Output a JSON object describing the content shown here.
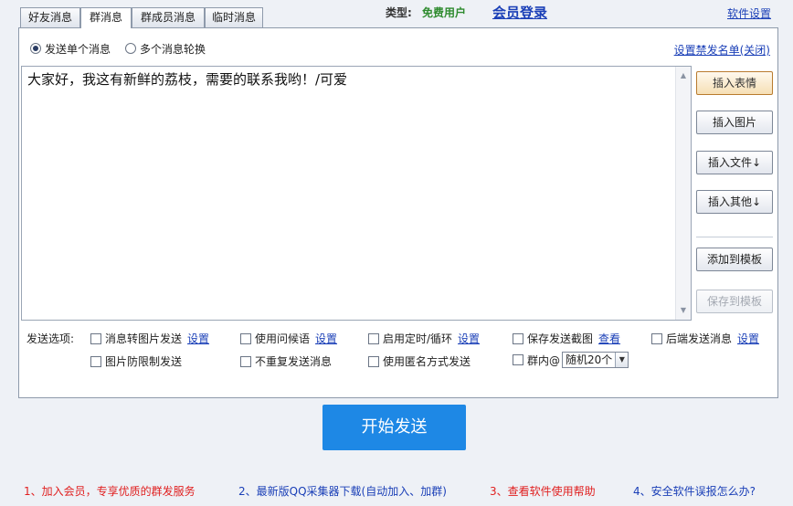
{
  "tabs": [
    {
      "label": "好友消息"
    },
    {
      "label": "群消息"
    },
    {
      "label": "群成员消息"
    },
    {
      "label": "临时消息"
    }
  ],
  "header": {
    "type_label": "类型:",
    "type_value": "免费用户",
    "member_login": "会员登录",
    "software_settings": "软件设置"
  },
  "send_mode": {
    "single": "发送单个消息",
    "multi": "多个消息轮换",
    "blacklist_link": "设置禁发名单(关闭)"
  },
  "editor": {
    "text": "大家好，我这有新鲜的荔枝，需要的联系我哟！/可爱"
  },
  "side_buttons": {
    "insert_emoji": "插入表情",
    "insert_image": "插入图片",
    "insert_file": "插入文件↓",
    "insert_other": "插入其他↓",
    "add_template": "添加到模板",
    "save_template": "保存到模板"
  },
  "options": {
    "label": "发送选项:",
    "msg_to_image": "消息转图片发送",
    "use_greeting": "使用问候语",
    "timer_loop": "启用定时/循环",
    "save_screenshot": "保存发送截图",
    "background_send": "后端发送消息",
    "image_anti_limit": "图片防限制发送",
    "no_repeat": "不重复发送消息",
    "anonymous": "使用匿名方式发送",
    "group_at": "群内@",
    "group_at_value": "随机20个",
    "settings_link": "设置",
    "view_link": "查看"
  },
  "start_button": "开始发送",
  "bottom_links": [
    {
      "text": "1、加入会员，专享优质的群发服务",
      "color": "#e02020"
    },
    {
      "text": "2、最新版QQ采集器下载(自动加入、加群)",
      "color": "#1a3fb7"
    },
    {
      "text": "3、查看软件使用帮助",
      "color": "#e02020"
    },
    {
      "text": "4、安全软件误报怎么办?",
      "color": "#1a3fb7"
    }
  ],
  "colors": {
    "accent_blue": "#1e88e5",
    "link_blue": "#1a3fb7",
    "free_user_green": "#2e8b2e",
    "warning_red": "#e02020"
  }
}
